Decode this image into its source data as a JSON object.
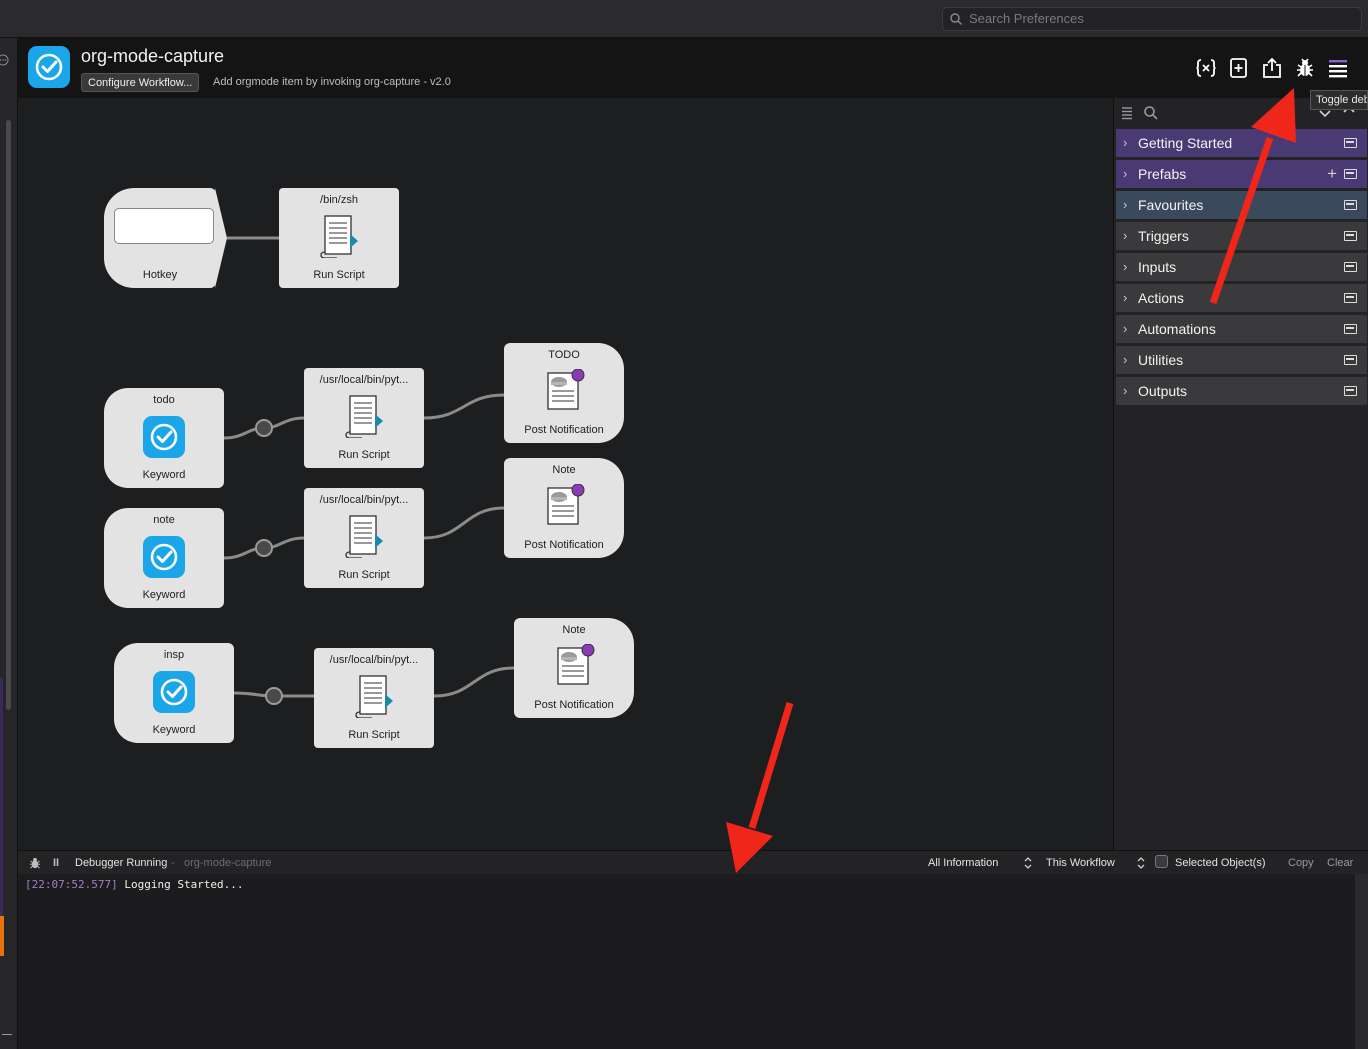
{
  "search": {
    "placeholder": "Search Preferences"
  },
  "header": {
    "title": "org-mode-capture",
    "configure_label": "Configure Workflow...",
    "description": "Add orgmode item by invoking org-capture - v2.0",
    "icons": [
      "variables-icon",
      "add-object-icon",
      "export-icon",
      "debug-icon",
      "menu-icon"
    ]
  },
  "canvas": {
    "nodes": {
      "hotkey": {
        "bottom": "Hotkey"
      },
      "zsh": {
        "top": "/bin/zsh",
        "bottom": "Run Script"
      },
      "kw_todo": {
        "top": "todo",
        "bottom": "Keyword"
      },
      "kw_note": {
        "top": "note",
        "bottom": "Keyword"
      },
      "kw_insp": {
        "top": "insp",
        "bottom": "Keyword"
      },
      "py1": {
        "top": "/usr/local/bin/pyt...",
        "bottom": "Run Script"
      },
      "py2": {
        "top": "/usr/local/bin/pyt...",
        "bottom": "Run Script"
      },
      "py3": {
        "top": "/usr/local/bin/pyt...",
        "bottom": "Run Script"
      },
      "notif1": {
        "top": "TODO",
        "bottom": "Post Notification"
      },
      "notif2": {
        "top": "Note",
        "bottom": "Post Notification"
      },
      "notif3": {
        "top": "Note",
        "bottom": "Post Notification"
      }
    }
  },
  "library": {
    "tooltip": "Toggle debugger",
    "items": [
      {
        "label": "Getting Started",
        "color": "#4a3a73"
      },
      {
        "label": "Prefabs",
        "color": "#4a3a73"
      },
      {
        "label": "Favourites",
        "color": "#3a4a5c"
      },
      {
        "label": "Triggers",
        "color": "#3a3a3c"
      },
      {
        "label": "Inputs",
        "color": "#3a3a3c"
      },
      {
        "label": "Actions",
        "color": "#3a3a3c"
      },
      {
        "label": "Automations",
        "color": "#3a3a3c"
      },
      {
        "label": "Utilities",
        "color": "#3a3a3c"
      },
      {
        "label": "Outputs",
        "color": "#3a3a3c"
      }
    ]
  },
  "debugger": {
    "status": "Debugger Running",
    "separator": " - ",
    "workflow": "org-mode-capture",
    "filter_info": "All Information",
    "filter_scope": "This Workflow",
    "selected_label": "Selected Object(s)",
    "copy_label": "Copy",
    "clear_label": "Clear",
    "log": [
      {
        "time": "[22:07:52.577]",
        "message": "Logging Started..."
      }
    ]
  },
  "colors": {
    "accent": "#1aa6e8",
    "arrow": "#f0261b",
    "purple_dot": "#8b3bb8"
  }
}
